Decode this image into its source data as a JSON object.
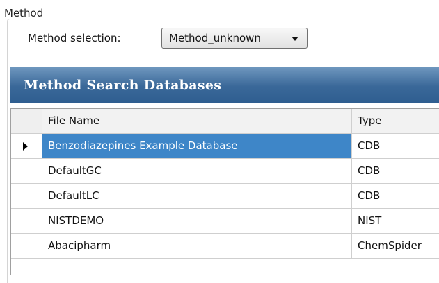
{
  "group": {
    "title": "Method"
  },
  "method_selection": {
    "label": "Method selection:",
    "value": "Method_unknown"
  },
  "databases": {
    "title": "Method Search Databases",
    "columns": [
      "File Name",
      "Type"
    ],
    "rows": [
      {
        "file_name": "Benzodiazepines Example Database",
        "type": "CDB",
        "selected": true
      },
      {
        "file_name": "DefaultGC",
        "type": "CDB"
      },
      {
        "file_name": "DefaultLC",
        "type": "CDB"
      },
      {
        "file_name": "NISTDEMO",
        "type": "NIST"
      },
      {
        "file_name": "Abacipharm",
        "type": "ChemSpider"
      }
    ]
  },
  "colors": {
    "header_band": "#3a6899",
    "selected_row": "#3e86c8"
  },
  "icons": {
    "dropdown": "chevron-down-icon",
    "row_indicator": "row-pointer-icon"
  }
}
